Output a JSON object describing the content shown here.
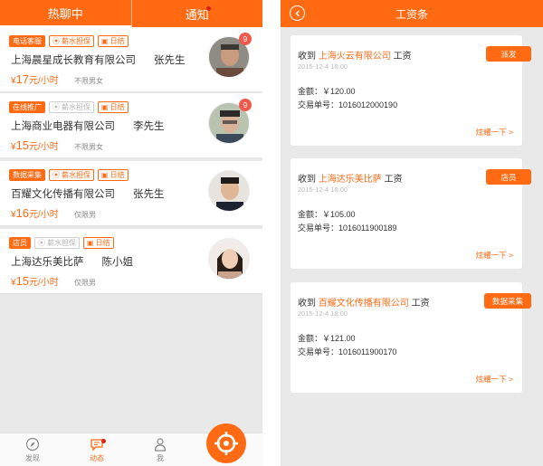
{
  "left": {
    "tabs": [
      {
        "label": "热聊中"
      },
      {
        "label": "通知"
      }
    ],
    "jobs": [
      {
        "type_tag": "电话客服",
        "guarantee_tag": "薪水担保",
        "settle_tag": "日结",
        "company": "上海晨星成长教育有限公司",
        "contact": "张先生",
        "pay_prefix": "¥",
        "pay_value": "17",
        "pay_unit": "元/小时",
        "gender": "不限男女",
        "badge": "9"
      },
      {
        "type_tag": "在线推广",
        "guarantee_tag": "薪水担保",
        "settle_tag": "日结",
        "company": "上海商业电器有限公司",
        "contact": "李先生",
        "pay_prefix": "¥",
        "pay_value": "15",
        "pay_unit": "元/小时",
        "gender": "不限男女",
        "badge": "9"
      },
      {
        "type_tag": "数据采集",
        "guarantee_tag": "薪水担保",
        "settle_tag": "日结",
        "company": "百耀文化传播有限公司",
        "contact": "张先生",
        "pay_prefix": "¥",
        "pay_value": "16",
        "pay_unit": "元/小时",
        "gender": "仅限男",
        "badge": ""
      },
      {
        "type_tag": "店员",
        "guarantee_tag": "薪水担保",
        "settle_tag": "日结",
        "company": "上海达乐美比萨",
        "contact": "陈小姐",
        "pay_prefix": "¥",
        "pay_value": "15",
        "pay_unit": "元/小时",
        "gender": "仅限男",
        "badge": ""
      }
    ],
    "nav": [
      {
        "label": "发现",
        "icon": "compass-icon"
      },
      {
        "label": "动态",
        "icon": "chat-bubble-icon"
      },
      {
        "label": "我",
        "icon": "person-icon"
      }
    ],
    "fab_icon": "crosshair-icon"
  },
  "right": {
    "title": "工资条",
    "slips": [
      {
        "prefix": "收到",
        "company": "上海火云有限公司",
        "suffix": "工资",
        "date": "2015-12-4   18:00",
        "type": "派发",
        "amount": "金额：￥120.00",
        "txn": "交易单号：1016012000190",
        "show_off": "炫耀一下 >"
      },
      {
        "prefix": "收到",
        "company": "上海达乐美比萨",
        "suffix": "工资",
        "date": "2015-12-4   18:00",
        "type": "店员",
        "amount": "金额：￥105.00",
        "txn": "交易单号：1016011900189",
        "show_off": "炫耀一下 >"
      },
      {
        "prefix": "收到",
        "company": "百耀文化传播有限公司",
        "suffix": "工资",
        "date": "2015-12-4   18:00",
        "type": "数据采集",
        "amount": "金额：￥121.00",
        "txn": "交易单号：1016011900170",
        "show_off": "炫耀一下 >"
      }
    ]
  },
  "colors": {
    "accent": "#ff6a13",
    "badge": "#ef5a4c",
    "background": "#e9e9e9"
  }
}
